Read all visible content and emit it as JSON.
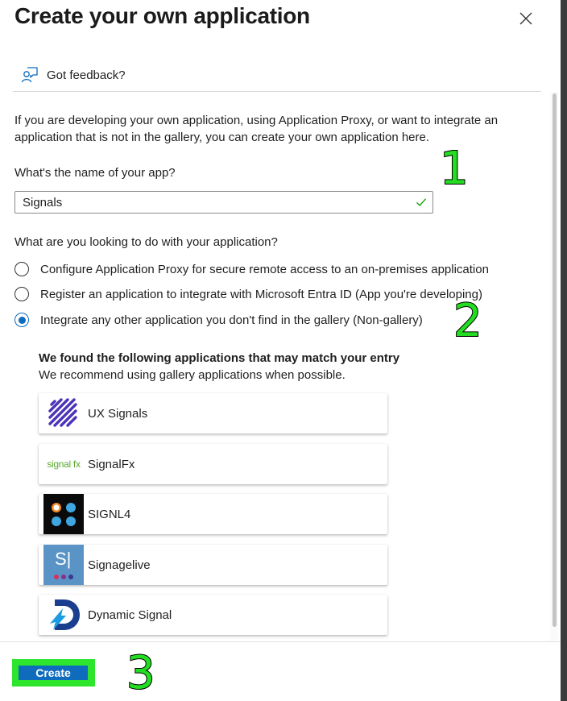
{
  "dialog": {
    "title": "Create your own application",
    "feedback_label": "Got feedback?",
    "intro": "If you are developing your own application, using Application Proxy, or want to integrate an application that is not in the gallery, you can create your own application here."
  },
  "app_name": {
    "label": "What's the name of your app?",
    "value": "Signals",
    "valid": true
  },
  "purpose": {
    "question": "What are you looking to do with your application?",
    "selected_index": 2,
    "options": [
      {
        "label": "Configure Application Proxy for secure remote access to an on-premises application"
      },
      {
        "label": "Register an application to integrate with Microsoft Entra ID (App you're developing)"
      },
      {
        "label": "Integrate any other application you don't find in the gallery (Non-gallery)"
      }
    ]
  },
  "matches": {
    "title": "We found the following applications that may match your entry",
    "subtitle": "We recommend using gallery applications when possible.",
    "items": [
      {
        "label": "UX Signals",
        "icon": "ux-signals-logo"
      },
      {
        "label": "SignalFx",
        "icon": "signalfx-logo",
        "logo_text": "signal fx"
      },
      {
        "label": "SIGNL4",
        "icon": "signl4-logo"
      },
      {
        "label": "Signagelive",
        "icon": "signagelive-logo",
        "logo_text": "S|"
      },
      {
        "label": "Dynamic Signal",
        "icon": "dynamic-signal-logo"
      }
    ]
  },
  "footer": {
    "create_label": "Create"
  },
  "annotations": {
    "step1": "1",
    "step2": "2",
    "step3": "3"
  },
  "colors": {
    "accent": "#0f6cbd",
    "annotation_green": "#22dd22",
    "highlight_green": "#2ee52e",
    "valid_check": "#13a10e"
  }
}
